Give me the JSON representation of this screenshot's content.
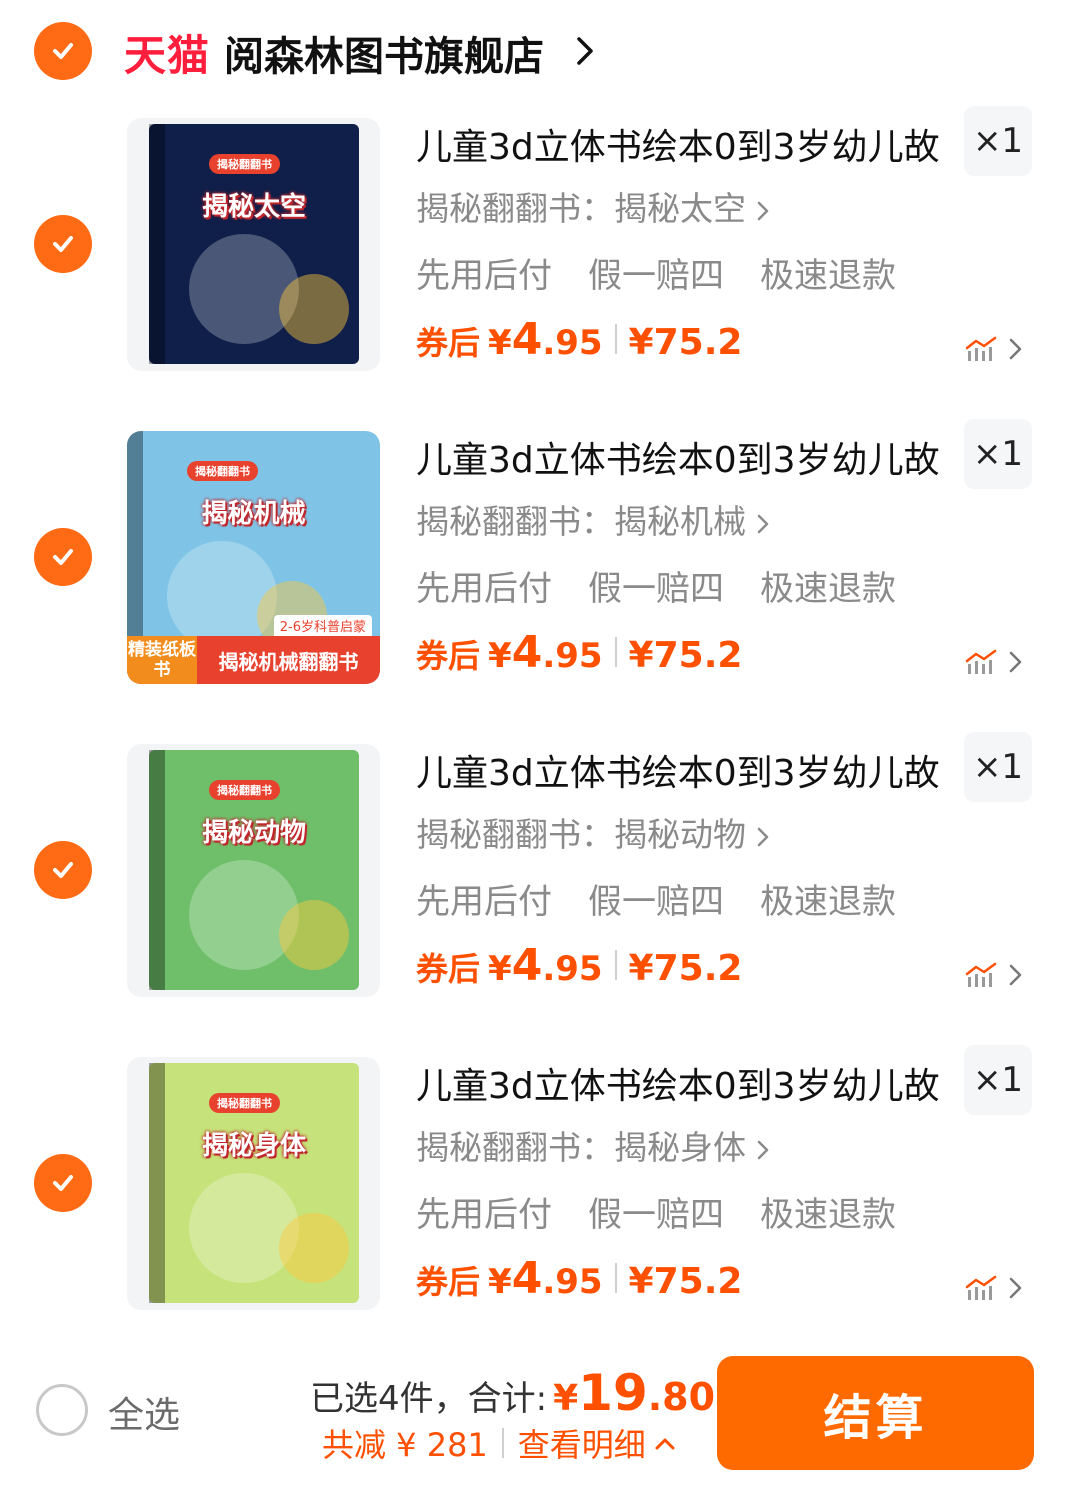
{
  "store": {
    "logo_text": "天猫",
    "name": "阅森林图书旗舰店"
  },
  "items": [
    {
      "cover_title": "揭秘太空",
      "cover_badge": "揭秘翻翻书",
      "cover_color": "#0f1f4a",
      "title": "儿童3d立体书绘本0到3岁幼儿故",
      "quantity": "×1",
      "sku": "揭秘翻翻书：揭秘太空",
      "services": [
        "先用后付",
        "假一赔四",
        "极速退款"
      ],
      "price_label": "券后",
      "price_yen": "¥",
      "price_int": "4",
      "price_dec": ".95",
      "original_price": "¥75.2"
    },
    {
      "cover_title": "揭秘机械",
      "cover_badge": "揭秘翻翻书",
      "cover_color": "#7fc4e6",
      "ribbon_left": "精装纸板书",
      "ribbon_right": "揭秘机械翻翻书",
      "ribbon_top": "2-6岁科普启蒙",
      "title": "儿童3d立体书绘本0到3岁幼儿故",
      "quantity": "×1",
      "sku": "揭秘翻翻书：揭秘机械",
      "services": [
        "先用后付",
        "假一赔四",
        "极速退款"
      ],
      "price_label": "券后",
      "price_yen": "¥",
      "price_int": "4",
      "price_dec": ".95",
      "original_price": "¥75.2"
    },
    {
      "cover_title": "揭秘动物",
      "cover_badge": "揭秘翻翻书",
      "cover_color": "#6fbf6a",
      "title": "儿童3d立体书绘本0到3岁幼儿故",
      "quantity": "×1",
      "sku": "揭秘翻翻书：揭秘动物",
      "services": [
        "先用后付",
        "假一赔四",
        "极速退款"
      ],
      "price_label": "券后",
      "price_yen": "¥",
      "price_int": "4",
      "price_dec": ".95",
      "original_price": "¥75.2"
    },
    {
      "cover_title": "揭秘身体",
      "cover_badge": "揭秘翻翻书",
      "cover_color": "#c6e27a",
      "title": "儿童3d立体书绘本0到3岁幼儿故",
      "quantity": "×1",
      "sku": "揭秘翻翻书：揭秘身体",
      "services": [
        "先用后付",
        "假一赔四",
        "极速退款"
      ],
      "price_label": "券后",
      "price_yen": "¥",
      "price_int": "4",
      "price_dec": ".95",
      "original_price": "¥75.2"
    }
  ],
  "footer": {
    "select_all_label": "全选",
    "selected_summary": "已选4件，合计:",
    "total_yen": "¥",
    "total_int": "19",
    "total_dec": ".80",
    "saving_text": "共减 ¥ 281",
    "detail_text": "查看明细",
    "checkout_label": "结算"
  },
  "colors": {
    "accent": "#ff5000",
    "check": "#ff6a14",
    "tmall": "#ff1f3d",
    "checkout": "#ff6a00"
  }
}
